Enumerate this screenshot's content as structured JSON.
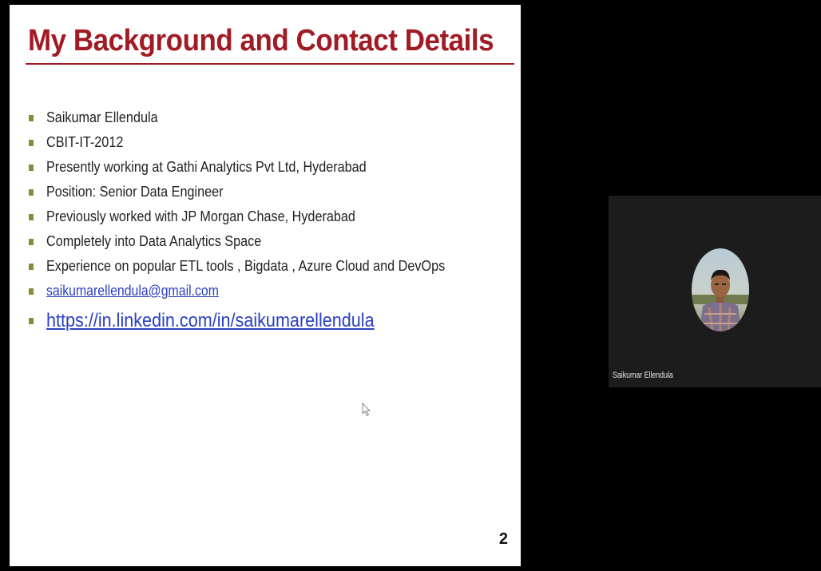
{
  "slide": {
    "title": "My Background and Contact Details",
    "bullets": [
      "Saikumar Ellendula",
      "CBIT-IT-2012",
      "Presently working at Gathi Analytics Pvt Ltd, Hyderabad",
      "Position: Senior Data Engineer",
      "Previously worked with JP Morgan Chase, Hyderabad",
      "Completely into Data Analytics Space",
      "Experience on popular ETL tools , Bigdata , Azure Cloud and DevOps"
    ],
    "email_link": "saikumarellendula@gmail.com",
    "linkedin_link": "https://in.linkedin.com/in/saikumarellendula",
    "page_number": "2",
    "colors": {
      "title": "#a11b24",
      "bullet": "#8a8a3a",
      "link": "#2a3fc4"
    }
  },
  "video": {
    "participant_name": "Saikumar Ellendula",
    "avatar_icon": "participant-photo"
  }
}
